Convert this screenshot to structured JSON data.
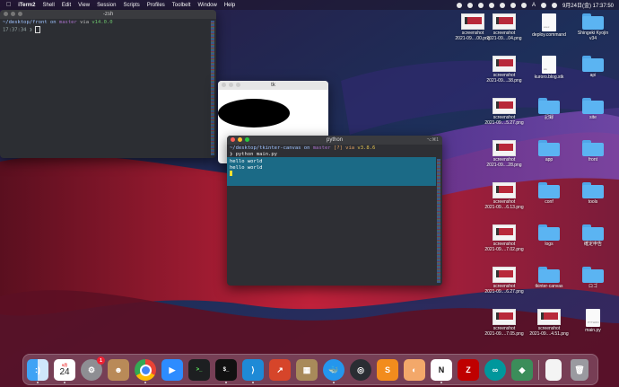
{
  "menubar": {
    "app_name": "iTerm2",
    "items": [
      "Shell",
      "Edit",
      "View",
      "Session",
      "Scripts",
      "Profiles",
      "Toolbelt",
      "Window",
      "Help"
    ],
    "status": {
      "ime": "A",
      "clock": "9月24日(金) 17:37:50"
    }
  },
  "terminal_left": {
    "title": "-zsh",
    "line1_prefix": "~/desktop/front on ",
    "line1_branch": "master",
    "line1_via": " via ",
    "line1_node": "v14.0.0",
    "line2": "17:37:34 ❯ "
  },
  "tk_window": {
    "title": "tk"
  },
  "terminal_python": {
    "title": "python",
    "shortcut": "⌥⌘1",
    "line1_prefix": "~/desktop/tkinter-canvas on ",
    "line1_branch": "master",
    "line1_status": " [?] via ",
    "line1_py": "v3.8.6",
    "line2": "❯ python main.py",
    "output": [
      "hello world",
      "hello world"
    ]
  },
  "desktop": {
    "items": [
      {
        "label1": "screenshot",
        "label2": "2021-09....00.png",
        "kind": "shot"
      },
      {
        "label1": "screenshot",
        "label2": "2021-09....04.png",
        "kind": "shot"
      },
      {
        "label1": "deploy.command",
        "label2": "",
        "kind": "doc",
        "doc_text": "exec"
      },
      {
        "label1": "Shingeki Kyojin",
        "label2": "v34",
        "kind": "folder"
      },
      {
        "label1": "screenshot",
        "label2": "2021-09....38.png",
        "kind": "shot"
      },
      {
        "label1": "kuroro.blog.stk",
        "label2": "",
        "kind": "doc",
        "doc_text": "stk"
      },
      {
        "label1": "api",
        "label2": "",
        "kind": "folder"
      },
      {
        "label1": "screenshot",
        "label2": "2021-09....5.27.png",
        "kind": "shot"
      },
      {
        "label1": "記録",
        "label2": "",
        "kind": "folder"
      },
      {
        "label1": "site",
        "label2": "",
        "kind": "folder"
      },
      {
        "label1": "screenshot",
        "label2": "2021-09....28.png",
        "kind": "shot"
      },
      {
        "label1": "app",
        "label2": "",
        "kind": "folder"
      },
      {
        "label1": "front",
        "label2": "",
        "kind": "folder"
      },
      {
        "label1": "screenshot",
        "label2": "2021-09....6.13.png",
        "kind": "shot"
      },
      {
        "label1": "conf",
        "label2": "",
        "kind": "folder"
      },
      {
        "label1": "tools",
        "label2": "",
        "kind": "folder"
      },
      {
        "label1": "screenshot",
        "label2": "2021-09....7.02.png",
        "kind": "shot"
      },
      {
        "label1": "logs",
        "label2": "",
        "kind": "folder"
      },
      {
        "label1": "確定申告",
        "label2": "",
        "kind": "folder"
      },
      {
        "label1": "screenshot",
        "label2": "2021-09....6.27.png",
        "kind": "shot"
      },
      {
        "label1": "tkinter-canvas",
        "label2": "",
        "kind": "folder"
      },
      {
        "label1": "ロゴ",
        "label2": "",
        "kind": "folder"
      },
      {
        "label1": "screenshot",
        "label2": "2021-09....7.05.png",
        "kind": "shot"
      },
      {
        "label1": "screenshot",
        "label2": "2021-09....4.51.png",
        "kind": "shot"
      },
      {
        "label1": "main.py",
        "label2": "",
        "kind": "doc",
        "doc_text": "PYTHON"
      }
    ]
  },
  "dock": {
    "calendar_month": "9月",
    "calendar_day": "24",
    "settings_badge": "1",
    "apps": [
      "Finder",
      "Calendar",
      "System Preferences",
      "Contacts",
      "Chrome",
      "Zoom",
      "Terminal",
      "iTerm2",
      "VS Code",
      "Instruments",
      "Archive Utility",
      "Docker",
      "QuickTime",
      "Sublime",
      "Notes Helper",
      "Notion",
      "FileZilla",
      "Arduino",
      "App Green",
      "Document",
      "Trash"
    ]
  }
}
